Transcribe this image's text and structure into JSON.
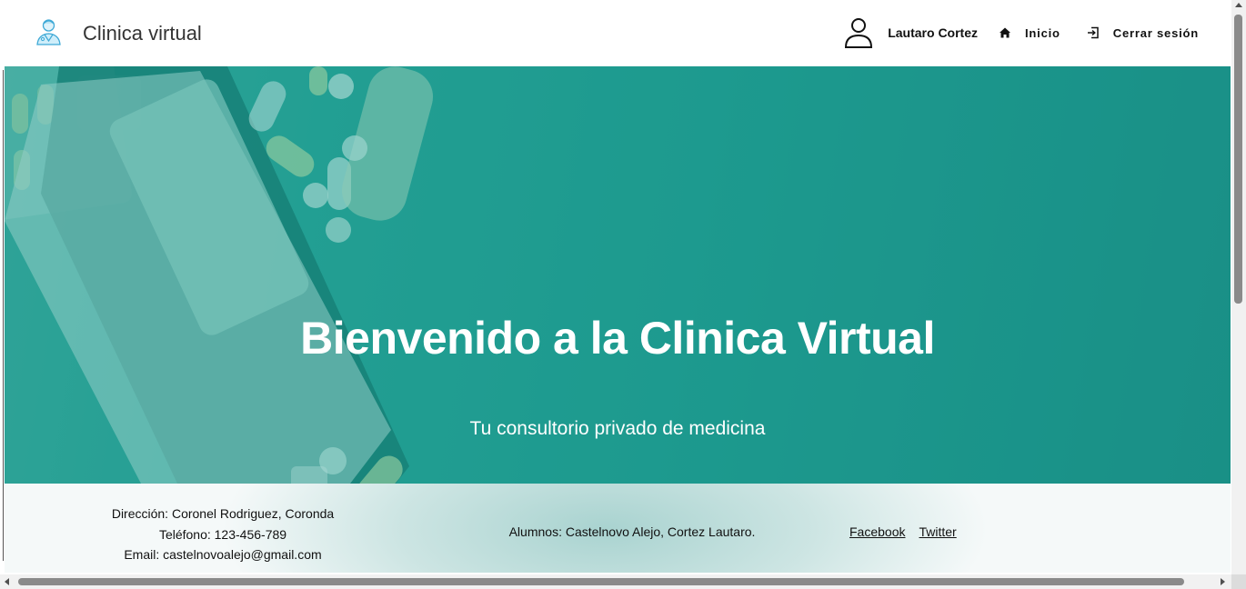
{
  "header": {
    "brand_title": "Clinica virtual",
    "logo_icon": "doctor-avatar-icon",
    "user_icon": "user-outline-icon",
    "user_name": "Lautaro Cortez",
    "nav": [
      {
        "label": "Inicio",
        "icon": "home-icon"
      },
      {
        "label": "Cerrar sesión",
        "icon": "logout-icon"
      }
    ]
  },
  "hero": {
    "title": "Bienvenido a la Clinica Virtual",
    "subtitle": "Tu consultorio privado de medicina",
    "background_color": "#1e9a8f"
  },
  "footer": {
    "address": "Dirección: Coronel Rodriguez, Coronda",
    "phone": "Teléfono: 123-456-789",
    "email": "Email: castelnovoalejo@gmail.com",
    "students": "Alumnos: Castelnovo Alejo, Cortez Lautaro.",
    "social": [
      {
        "label": "Facebook"
      },
      {
        "label": "Twitter"
      }
    ]
  },
  "colors": {
    "accent": "#1e9a8f",
    "text": "#111111"
  }
}
